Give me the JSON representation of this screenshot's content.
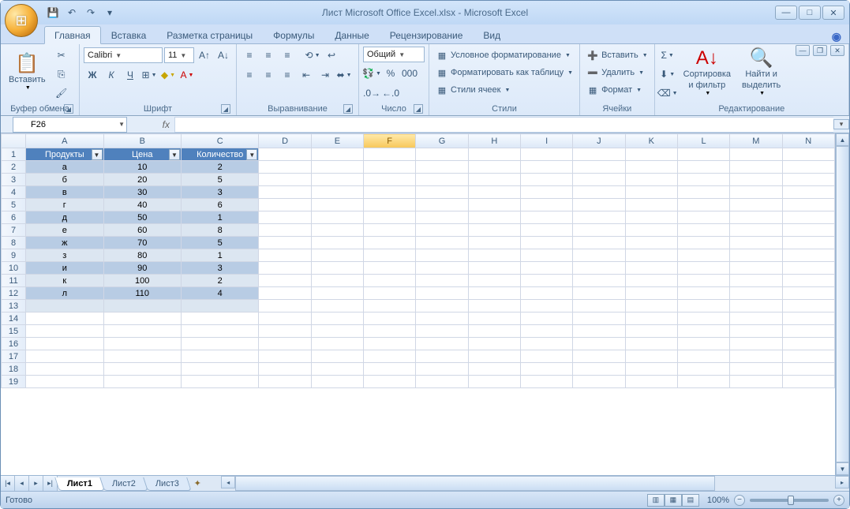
{
  "title": "Лист Microsoft Office Excel.xlsx - Microsoft Excel",
  "qat": {
    "save": "💾",
    "undo": "↶",
    "redo": "↷"
  },
  "tabs": [
    "Главная",
    "Вставка",
    "Разметка страницы",
    "Формулы",
    "Данные",
    "Рецензирование",
    "Вид"
  ],
  "activeTab": 0,
  "ribbon": {
    "clipboard": {
      "label": "Буфер обмена",
      "paste": "Вставить"
    },
    "font": {
      "label": "Шрифт",
      "name": "Calibri",
      "size": "11",
      "bold": "Ж",
      "italic": "К",
      "underline": "Ч"
    },
    "align": {
      "label": "Выравнивание"
    },
    "number": {
      "label": "Число",
      "format": "Общий"
    },
    "styles": {
      "label": "Стили",
      "cond": "Условное форматирование",
      "table": "Форматировать как таблицу",
      "cell": "Стили ячеек"
    },
    "cells": {
      "label": "Ячейки",
      "insert": "Вставить",
      "delete": "Удалить",
      "format": "Формат"
    },
    "editing": {
      "label": "Редактирование",
      "sort": "Сортировка\nи фильтр",
      "find": "Найти и\nвыделить"
    }
  },
  "namebox": "F26",
  "columns": [
    "A",
    "B",
    "C",
    "D",
    "E",
    "F",
    "G",
    "H",
    "I",
    "J",
    "K",
    "L",
    "M",
    "N"
  ],
  "rows": [
    1,
    2,
    3,
    4,
    5,
    6,
    7,
    8,
    9,
    10,
    11,
    12,
    13,
    14,
    15,
    16,
    17,
    18,
    19
  ],
  "headers": [
    "Продукты",
    "Цена",
    "Количество"
  ],
  "data": [
    [
      "а",
      "10",
      "2"
    ],
    [
      "б",
      "20",
      "5"
    ],
    [
      "в",
      "30",
      "3"
    ],
    [
      "г",
      "40",
      "6"
    ],
    [
      "д",
      "50",
      "1"
    ],
    [
      "е",
      "60",
      "8"
    ],
    [
      "ж",
      "70",
      "5"
    ],
    [
      "з",
      "80",
      "1"
    ],
    [
      "и",
      "90",
      "3"
    ],
    [
      "к",
      "100",
      "2"
    ],
    [
      "л",
      "110",
      "4"
    ]
  ],
  "sheets": [
    "Лист1",
    "Лист2",
    "Лист3"
  ],
  "activeSheet": 0,
  "status": "Готово",
  "zoom": "100%"
}
